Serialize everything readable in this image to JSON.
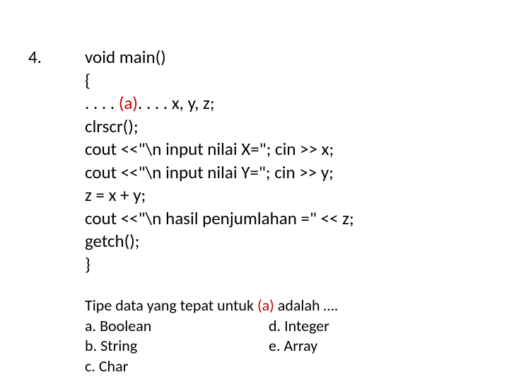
{
  "number": "4.",
  "code": {
    "l1": "void main()",
    "l2": "{",
    "l3a": ". . . . ",
    "l3b": "(a)",
    "l3c": ". . . .   x, y, z;",
    "l4": "clrscr();",
    "l5": "cout <<\"\\n input nilai X=\"; cin >> x;",
    "l6": "cout <<\"\\n input nilai Y=\"; cin >> y;",
    "l7": "z = x + y;",
    "l8": "cout <<\"\\n hasil penjumlahan =\" << z;",
    "l9": "getch();",
    "l10": "}"
  },
  "question": {
    "text_a": "Tipe data yang tepat untuk ",
    "text_b": "(a)",
    "text_c": " adalah …. ",
    "opts": {
      "a": "a. Boolean",
      "b": "b. String",
      "c": "c. Char",
      "d": "d. Integer",
      "e": "e. Array"
    }
  }
}
